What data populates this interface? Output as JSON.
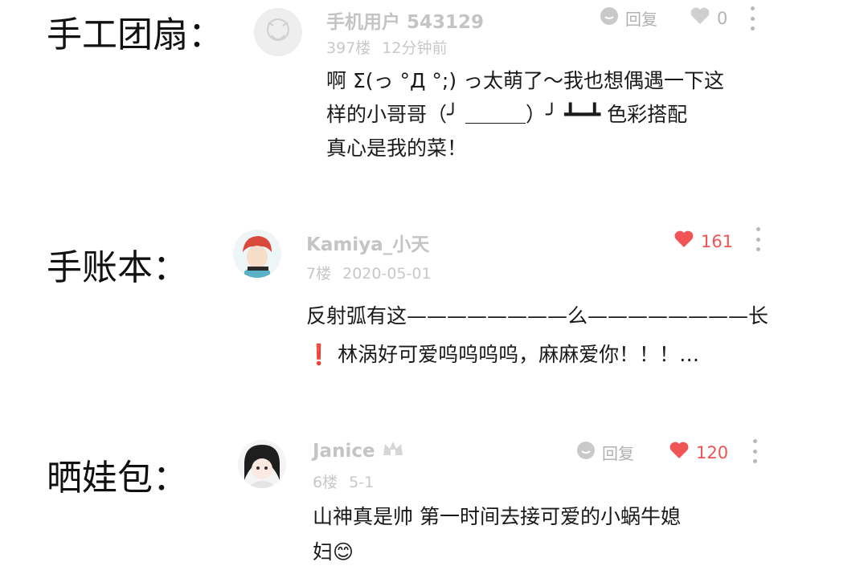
{
  "sections": [
    {
      "label": "手工团扇：",
      "comment": {
        "username": "手机用户 543129",
        "meta": "397楼 12分钟前",
        "lines": [
          "啊 Σ(っ °Д °;) っ太萌了～我也想偶遇一下这",
          "样的小哥哥（╯ ＿＿＿）╯ ┻━┻  色彩搭配",
          "真心是我的菜！"
        ],
        "reply_label": "回复",
        "like_count": "0"
      }
    },
    {
      "label": "手账本：",
      "comment": {
        "username": "Kamiya_小天",
        "meta": "7楼 2020-05-01",
        "lines": [
          "反射弧有这————————么————————长",
          "❗ 林涡好可爱呜呜呜呜，麻麻爱你！！！…"
        ],
        "like_count": "161"
      }
    },
    {
      "label": "晒娃包：",
      "comment": {
        "username": "Janice",
        "meta": "6楼 5-1",
        "lines": [
          "山神真是帅 第一时间去接可爱的小蜗牛媳",
          "妇😊"
        ],
        "reply_label": "回复",
        "like_count": "120"
      }
    }
  ],
  "colors": {
    "like_active": "#f05454",
    "muted": "#c4c4c4"
  },
  "icons": [
    "reply-icon",
    "heart-icon",
    "more-icon",
    "crown-icon"
  ]
}
